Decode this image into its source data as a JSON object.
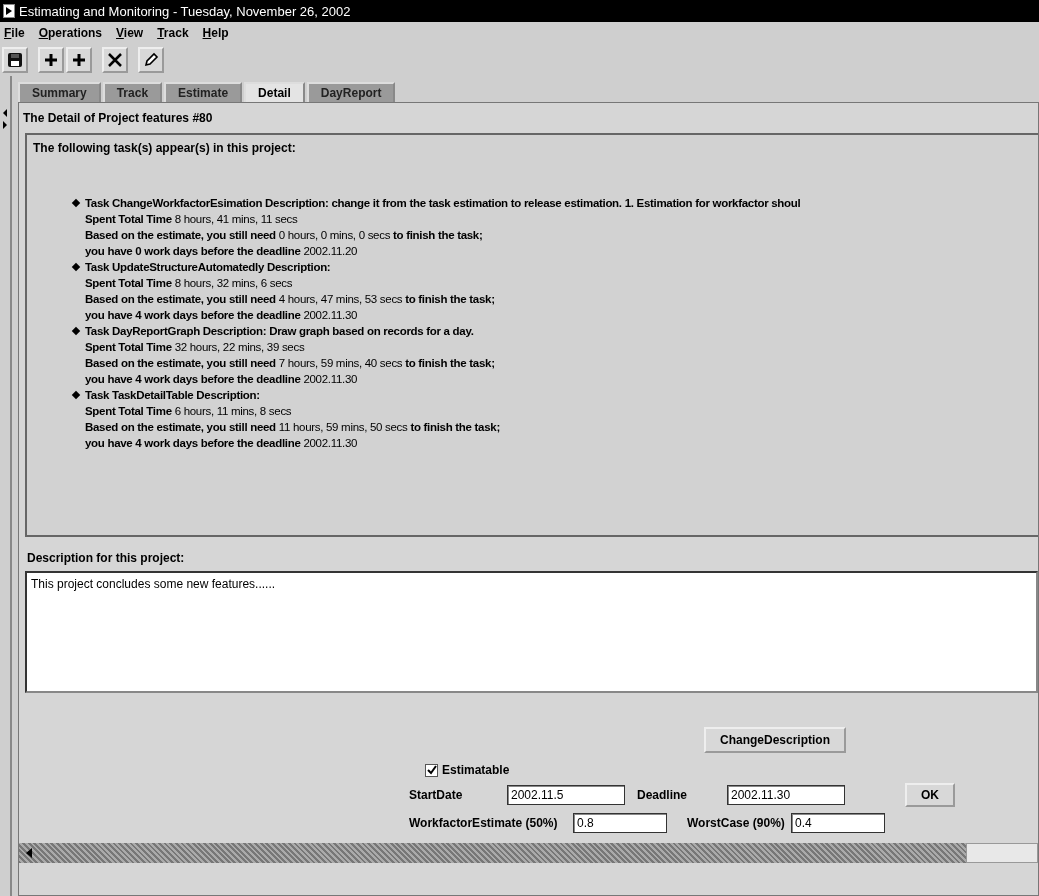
{
  "window": {
    "title": "Estimating and Monitoring - Tuesday, November 26, 2002"
  },
  "menu": [
    "File",
    "Operations",
    "View",
    "Track",
    "Help"
  ],
  "toolbar": [
    {
      "kind": "save"
    },
    {
      "kind": "add"
    },
    {
      "kind": "add"
    },
    {
      "kind": "delete"
    },
    {
      "kind": "edit"
    }
  ],
  "tabs": [
    {
      "label": "Summary",
      "selected": false
    },
    {
      "label": "Track",
      "selected": false
    },
    {
      "label": "Estimate",
      "selected": false
    },
    {
      "label": "Detail",
      "selected": true
    },
    {
      "label": "DayReport",
      "selected": false
    }
  ],
  "heading": "The Detail of Project features #80",
  "tasks_panel": {
    "intro": "The following task(s) appear(s) in this project:",
    "tasks": [
      {
        "lines": [
          "**Task ChangeWorkfactorEsimation Description: change it from the task estimation to release estimation. 1. Estimation for workfactor shoul**",
          "**Spent Total Time** 8 hours, 41 mins, 11 secs",
          "**Based on the estimate, you still need** 0 hours, 0 mins, 0 secs **to finish the task;**",
          "**you have 0 work days before the deadline** 2002.11.20"
        ]
      },
      {
        "lines": [
          "**Task UpdateStructureAutomatedly Description:**",
          "**Spent Total Time** 8 hours, 32 mins, 6 secs",
          "**Based on the estimate, you still need** 4 hours, 47 mins, 53 secs **to finish the task;**",
          "**you have 4 work days before the deadline** 2002.11.30"
        ]
      },
      {
        "lines": [
          "**Task DayReportGraph Description: Draw graph based on records for a day.**",
          "**Spent Total Time** 32 hours, 22 mins, 39 secs",
          "**Based on the estimate, you still need** 7 hours, 59 mins, 40 secs **to finish the task;**",
          "**you have 4 work days before the deadline** 2002.11.30"
        ]
      },
      {
        "lines": [
          "**Task TaskDetailTable Description:**",
          "**Spent Total Time** 6 hours, 11 mins, 8 secs",
          "**Based on the estimate, you still need** 11 hours, 59 mins, 50 secs **to finish the task;**",
          "**you have 4 work days before the deadline** 2002.11.30"
        ]
      }
    ]
  },
  "description": {
    "label": "Description for this project:",
    "value": "This project concludes some new features......"
  },
  "change_button": "ChangeDescription",
  "estimatable": {
    "label": "Estimatable",
    "checked": true
  },
  "start_date": {
    "label": "StartDate",
    "value": "2002.11.5"
  },
  "deadline": {
    "label": "Deadline",
    "value": "2002.11.30"
  },
  "ok_button": "OK",
  "workfactor": {
    "label": "WorkfactorEstimate (50%)",
    "value": "0.8"
  },
  "worst_case": {
    "label": "WorstCase (90%)",
    "value": "0.4"
  }
}
